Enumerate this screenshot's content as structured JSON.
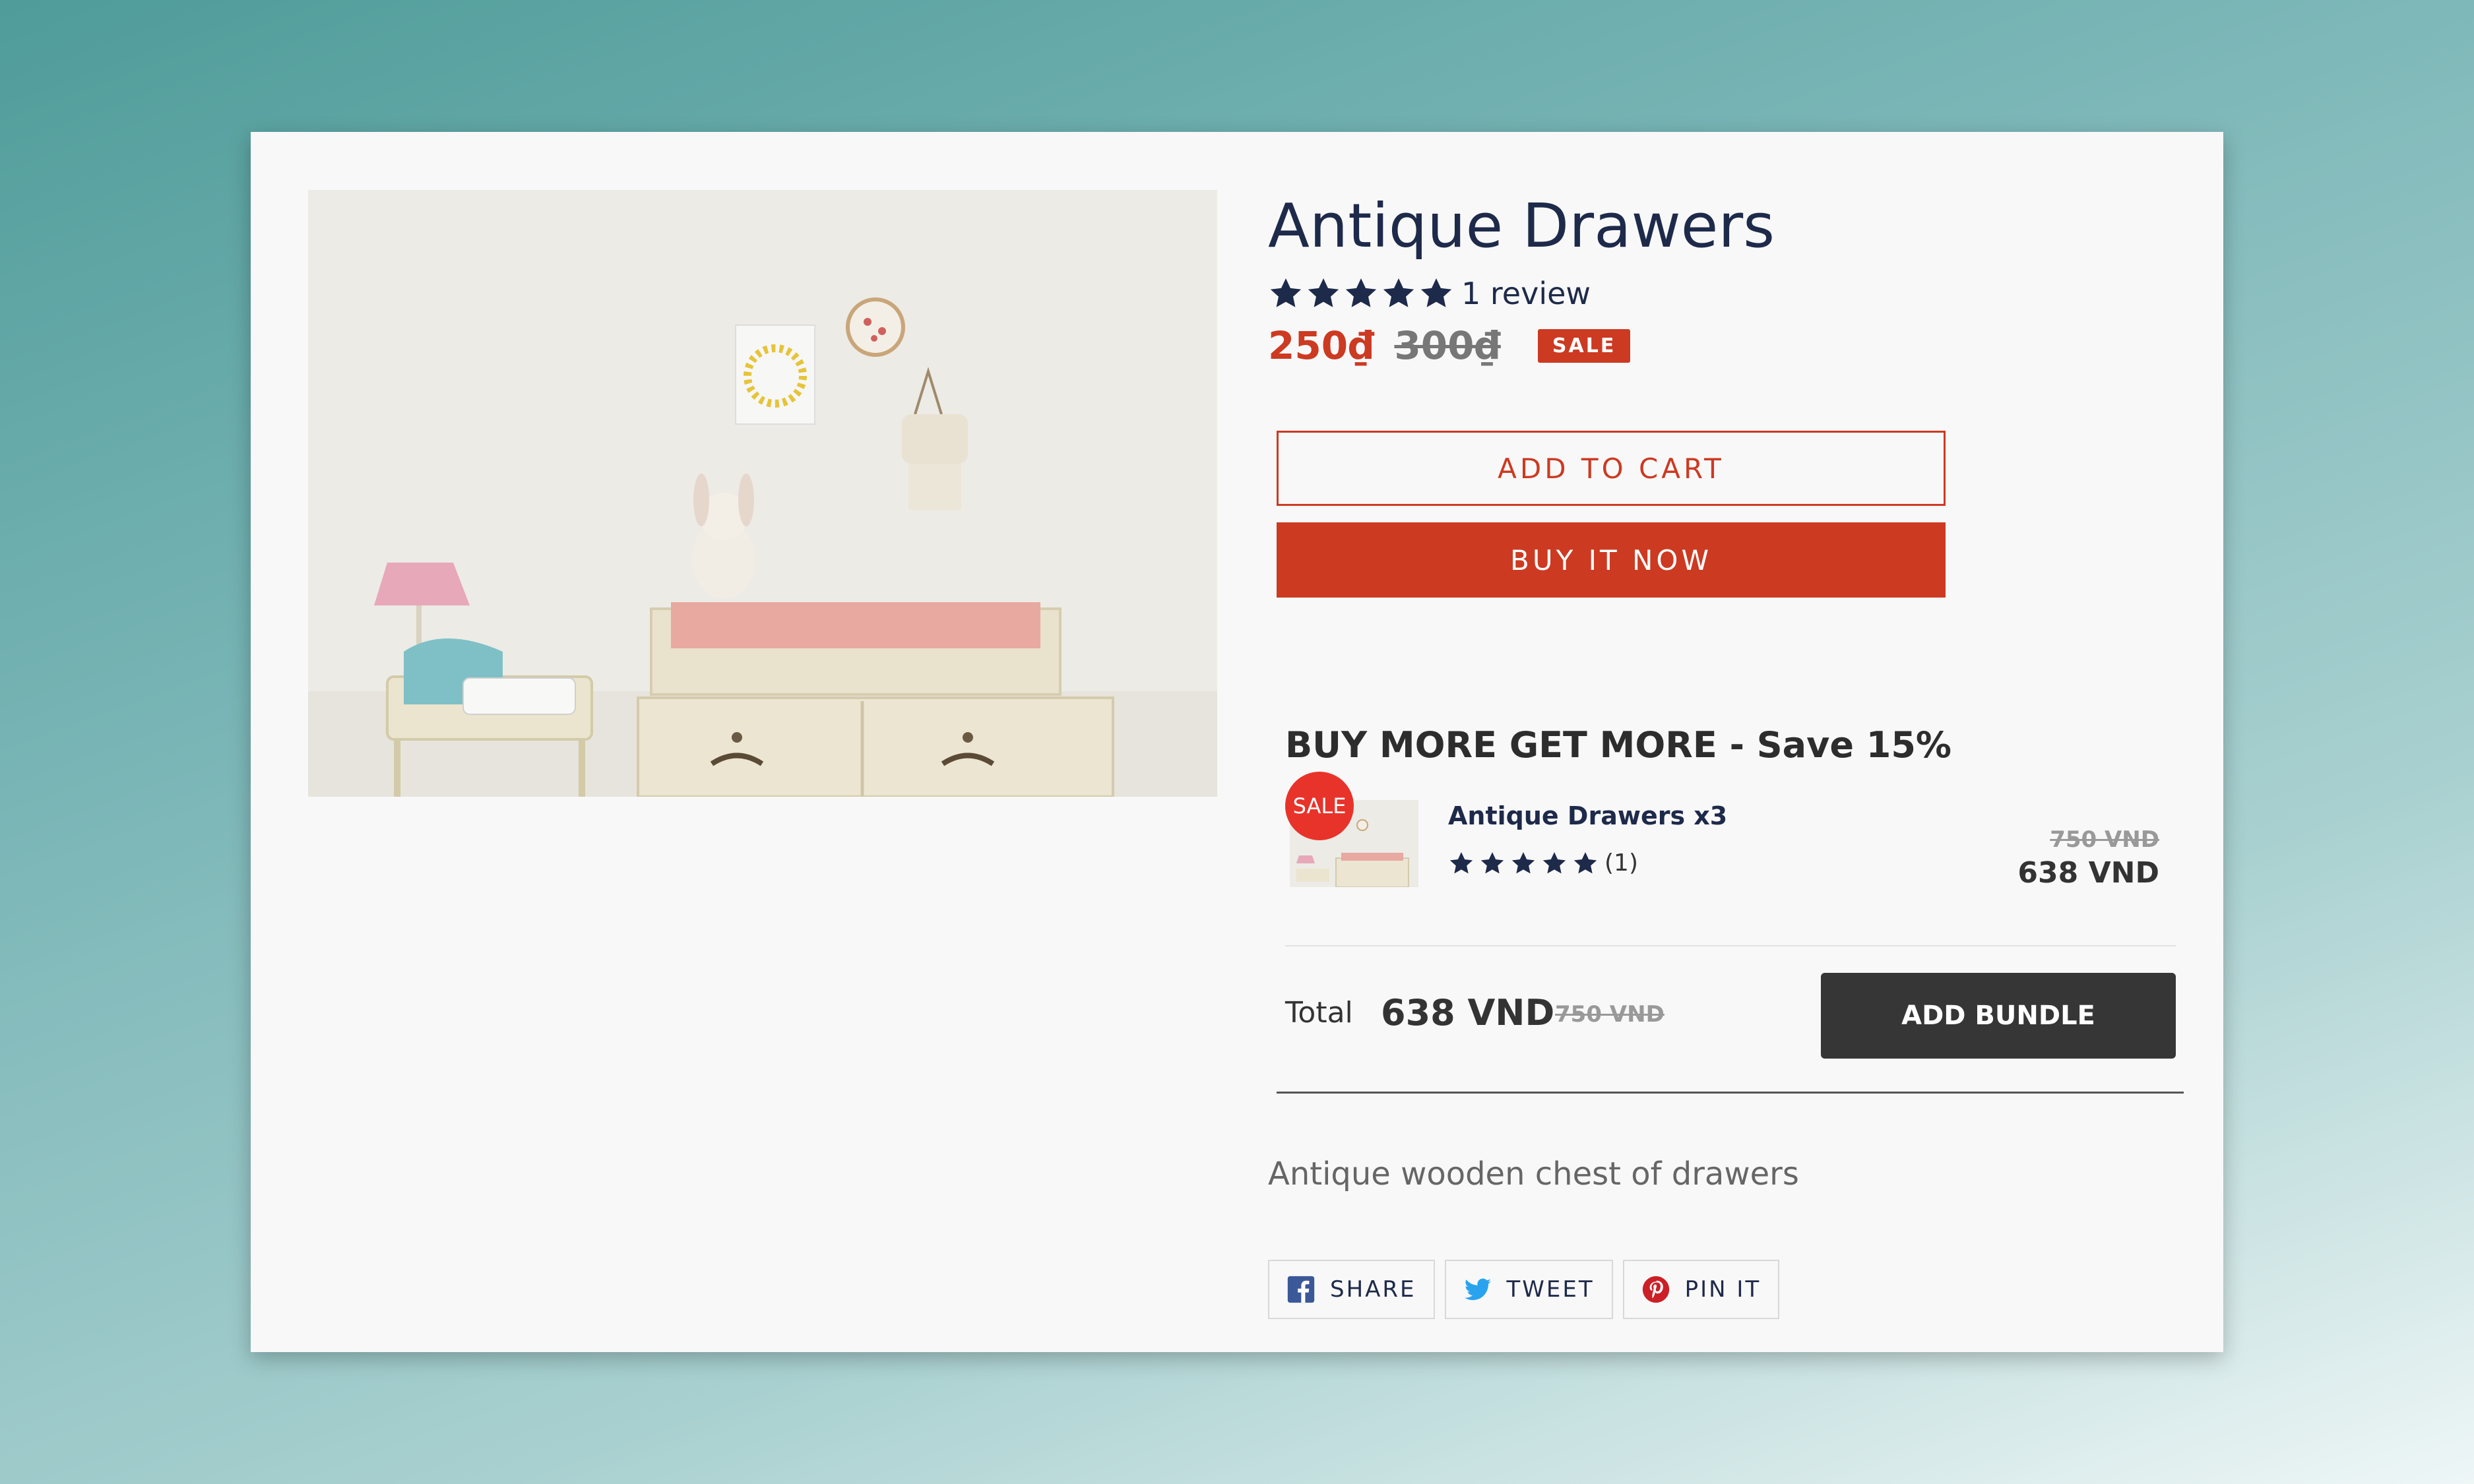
{
  "product": {
    "title": "Antique Drawers",
    "review_text": "1 review",
    "rating": 5,
    "price": "250₫",
    "compare_price": "300₫",
    "sale_badge": "SALE",
    "description": "Antique wooden chest of drawers"
  },
  "buttons": {
    "add_to_cart": "ADD TO CART",
    "buy_now": "BUY IT NOW"
  },
  "bundle": {
    "heading": "BUY MORE GET MORE - Save 15%",
    "sale_tag": "SALE",
    "item_name": "Antique Drawers x3",
    "item_rating": 5,
    "item_review_count": "(1)",
    "item_old_price": "750 VND",
    "item_new_price": "638 VND",
    "total_label": "Total",
    "total_value": "638 VND",
    "total_old": "750 VND",
    "add_bundle": "ADD BUNDLE"
  },
  "share": {
    "facebook": "SHARE",
    "twitter": "TWEET",
    "pinterest": "PIN IT"
  },
  "colors": {
    "accent": "#cc3a22",
    "navy": "#1e2a4a",
    "sale_circle": "#e8332a",
    "bundle_button": "#363636"
  },
  "icons": [
    "star-icon",
    "facebook-icon",
    "twitter-icon",
    "pinterest-icon"
  ]
}
